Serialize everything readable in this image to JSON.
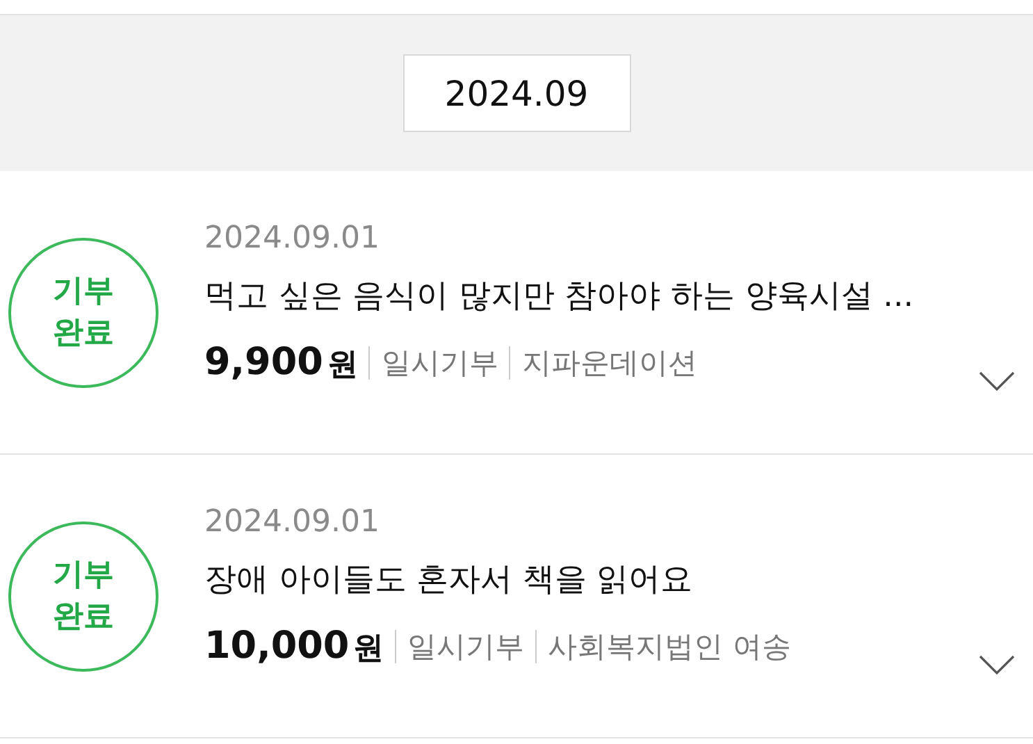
{
  "month": "2024.09",
  "donations": [
    {
      "badge": [
        "기부",
        "완료"
      ],
      "date": "2024.09.01",
      "title": "먹고 싶은 음식이 많지만 참아야 하는 양육시설 ...",
      "amount": "9,900",
      "unit": "원",
      "type": "일시기부",
      "org": "지파운데이션",
      "expanded": false
    },
    {
      "badge": [
        "기부",
        "완료"
      ],
      "date": "2024.09.01",
      "title": "장애 아이들도 혼자서 책을 읽어요",
      "amount": "10,000",
      "unit": "원",
      "type": "일시기부",
      "org": "사회복지법인 여송",
      "expanded": false
    }
  ]
}
